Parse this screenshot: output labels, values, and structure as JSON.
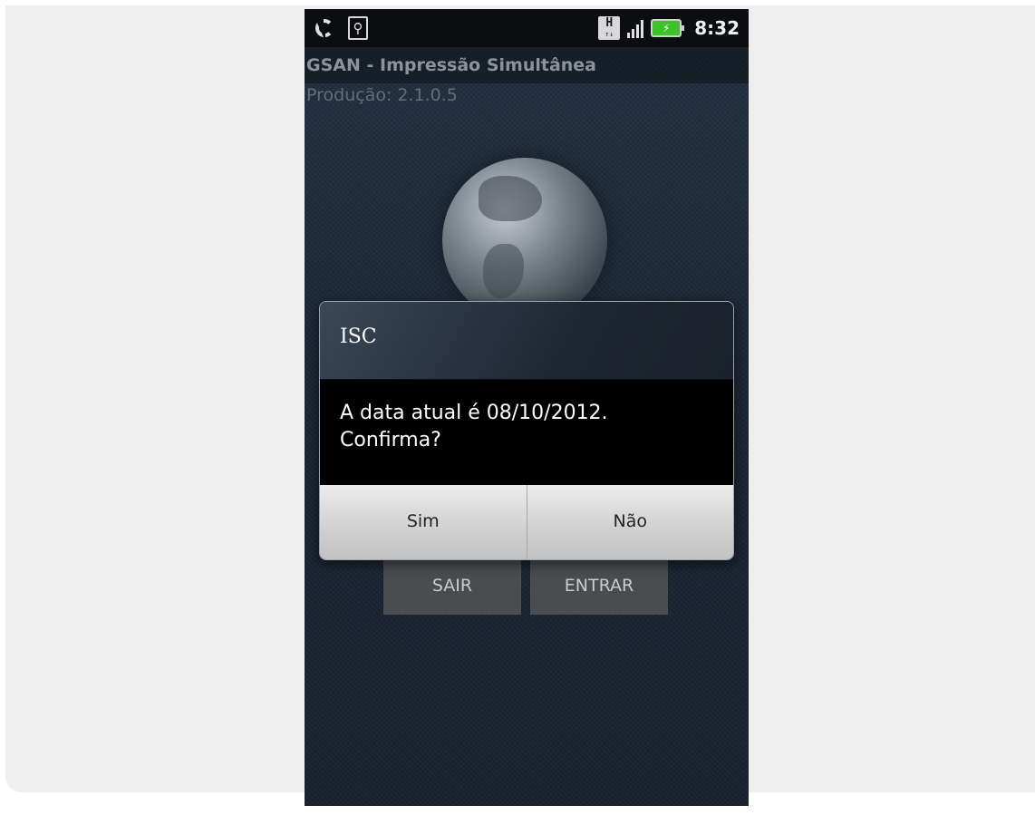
{
  "status_bar": {
    "time": "8:32",
    "icons": [
      "sync-icon",
      "usb-icon",
      "h-network-icon",
      "signal-icon",
      "battery-charging-icon"
    ],
    "h_label": "H",
    "battery_color": "#3cc32a"
  },
  "app": {
    "title": "GSAN - Impressão Simultânea",
    "version": "Produção: 2.1.0.5"
  },
  "background_buttons": {
    "exit_label": "SAIR",
    "enter_label": "ENTRAR"
  },
  "dialog": {
    "title": "ISC",
    "message": "A data atual é 08/10/2012.\nConfirma?",
    "yes_label": "Sim",
    "no_label": "Não"
  }
}
